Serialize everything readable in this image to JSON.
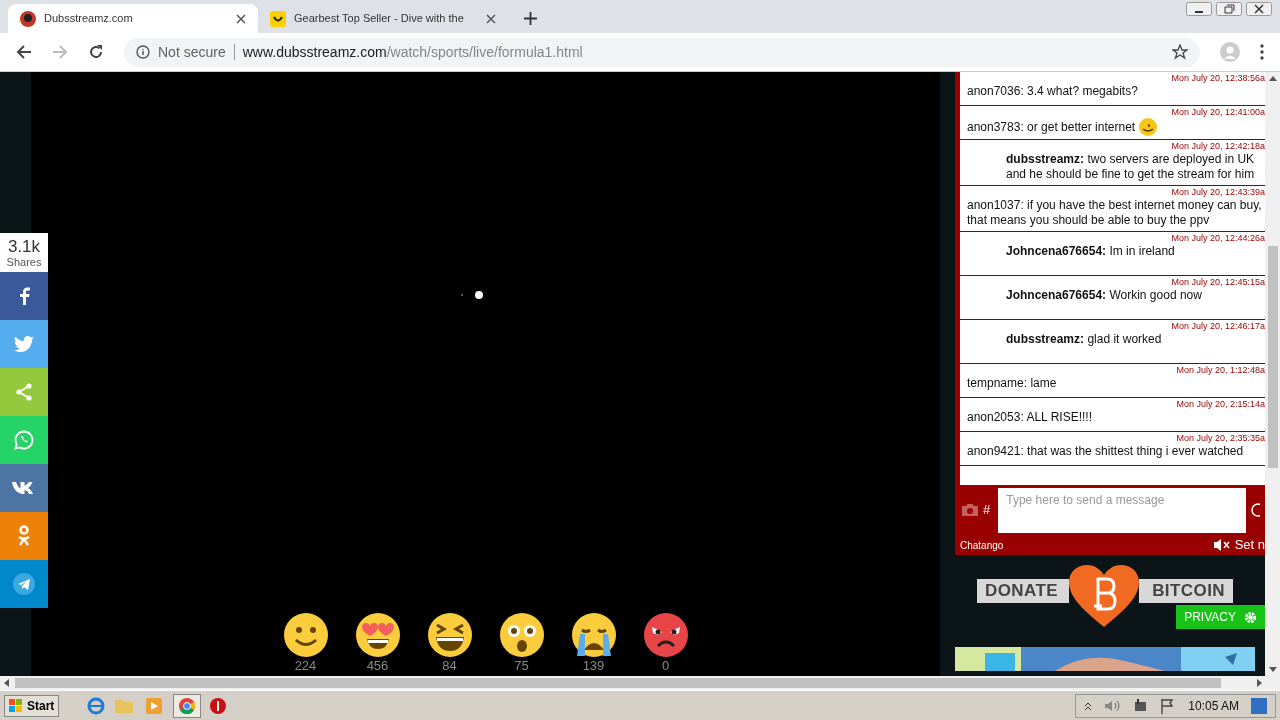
{
  "tabs": [
    {
      "title": "Dubsstreamz.com",
      "selected": true,
      "kind": "avatar"
    },
    {
      "title": "Gearbest Top Seller - Dive with the",
      "selected": false,
      "kind": "smile"
    }
  ],
  "address": {
    "security": "Not secure",
    "domain": "www.dubsstreamz.com",
    "path": "/watch/sports/live/formula1.html"
  },
  "share": {
    "count": "3.1k",
    "label": "Shares",
    "buttons": [
      {
        "kind": "facebook",
        "color": "#3b5998"
      },
      {
        "kind": "twitter",
        "color": "#55acee"
      },
      {
        "kind": "share",
        "color": "#95c93d"
      },
      {
        "kind": "whatsapp",
        "color": "#25d366"
      },
      {
        "kind": "vk",
        "color": "#4c75a3"
      },
      {
        "kind": "ok",
        "color": "#ee8208"
      },
      {
        "kind": "telegram",
        "color": "#0088cc"
      }
    ]
  },
  "chat": {
    "messages": [
      {
        "kind": "plain",
        "time": "Mon July 20, 12:38:56a",
        "user": "anon7036:",
        "text": "3.4 what? megabits?",
        "emoji": false
      },
      {
        "kind": "plain",
        "time": "Mon July 20, 12:41:00a",
        "user": "anon3783:",
        "text": "or get better internet",
        "emoji": true
      },
      {
        "kind": "owner",
        "time": "Mon July 20, 12:42:18a",
        "user": "dubsstreamz:",
        "text": "two servers are deployed in UK and he should be fine to get the stream for him",
        "emoji": false
      },
      {
        "kind": "plain",
        "time": "Mon July 20, 12:43:39a",
        "user": "anon1037:",
        "text": "if you have the best internet money can buy, that means you should be able to buy the ppv",
        "emoji": false
      },
      {
        "kind": "owner",
        "time": "Mon July 20, 12:44:26a",
        "user": "Johncena676654:",
        "text": "Im in ireland",
        "emoji": false
      },
      {
        "kind": "owner",
        "time": "Mon July 20, 12:45:15a",
        "user": "Johncena676654:",
        "text": "Workin good now",
        "emoji": false
      },
      {
        "kind": "owner",
        "time": "Mon July 20, 12:46:17a",
        "user": "dubsstreamz:",
        "text": "glad it worked",
        "emoji": false
      },
      {
        "kind": "plain",
        "time": "Mon July 20, 1:12:48a",
        "user": "tempname:",
        "text": "lame",
        "emoji": false
      },
      {
        "kind": "plain",
        "time": "Mon July 20, 2:15:14a",
        "user": "anon2053:",
        "text": "ALL RISE!!!!",
        "emoji": false
      },
      {
        "kind": "plain",
        "time": "Mon July 20, 2:35:35a",
        "user": "anon9421:",
        "text": "that was the shittest thing i ever watched",
        "emoji": false
      }
    ],
    "hash": "#",
    "placeholder": "Type here to send a message",
    "brand": "Chatango",
    "sound_label": "Set n"
  },
  "donate": {
    "left": "DONATE",
    "right": "BITCOIN",
    "privacy": "PRIVACY"
  },
  "reactions": [
    {
      "kind": "smile",
      "count": "224"
    },
    {
      "kind": "love",
      "count": "456"
    },
    {
      "kind": "laugh",
      "count": "84"
    },
    {
      "kind": "wow",
      "count": "75"
    },
    {
      "kind": "sad",
      "count": "139"
    },
    {
      "kind": "angry",
      "count": "0"
    }
  ],
  "taskbar": {
    "start": "Start",
    "time": "10:05 AM"
  }
}
